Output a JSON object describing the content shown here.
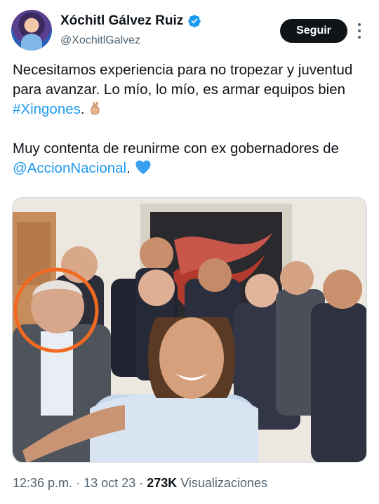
{
  "author": {
    "display_name": "Xóchitl Gálvez Ruiz",
    "handle": "@XochitlGalvez",
    "verified": true,
    "avatar_icon": "profile-avatar"
  },
  "actions": {
    "follow_label": "Seguir",
    "more_icon": "more-vertical-icon"
  },
  "tweet": {
    "line1_text": "Necesitamos experiencia para no tropezar y juventud para avanzar. Lo mío, lo mío, es armar equipos bien ",
    "hashtag": "#Xingones",
    "line1_suffix": ".",
    "line2_text": "Muy contenta de reunirme con ex gobernadores de ",
    "mention": "@AccionNacional",
    "line2_suffix": ".",
    "emoji_1": "crossed-fingers-emoji",
    "emoji_2": "blue-heart-emoji"
  },
  "media": {
    "type": "photo",
    "subject": "group-selfie",
    "highlight": "orange-circle-annotation"
  },
  "meta": {
    "time": "12:36 p.m.",
    "separator": "·",
    "date": "13 oct 23",
    "views_count": "273K",
    "views_label": "Visualizaciones"
  },
  "colors": {
    "link": "#1d9bf0",
    "text": "#0f1419",
    "secondary": "#536471",
    "button_bg": "#0f1419",
    "highlight_circle": "#f26a21"
  }
}
